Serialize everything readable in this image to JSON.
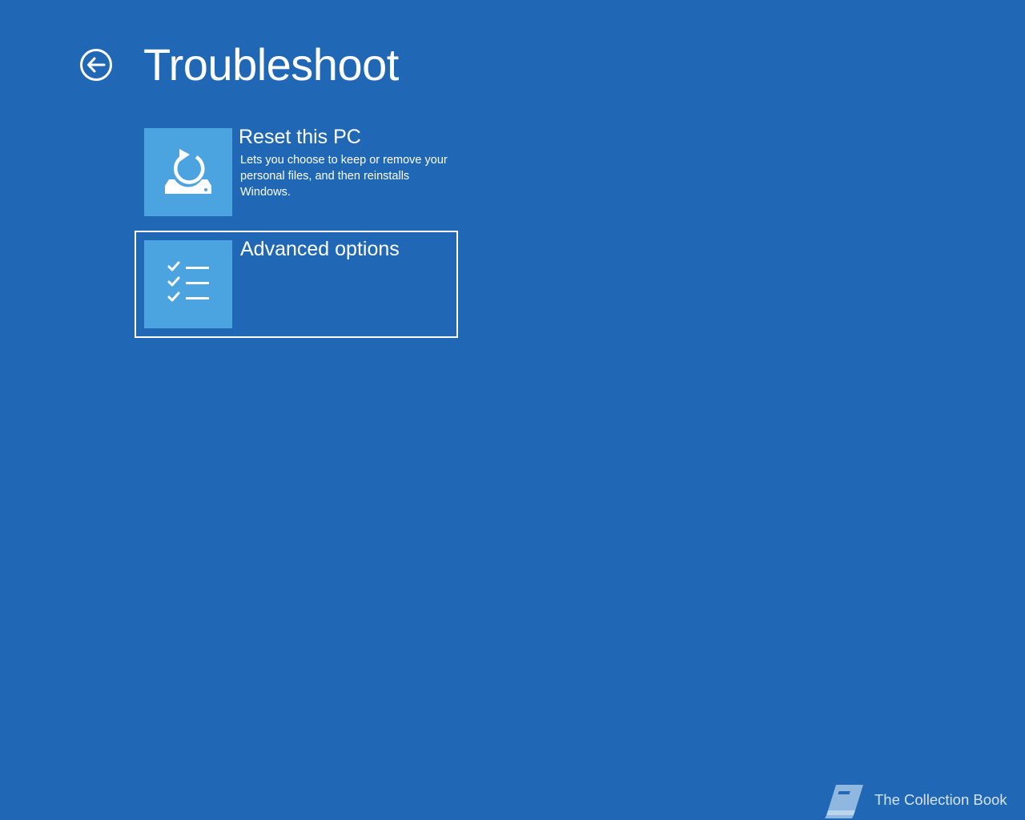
{
  "page": {
    "title": "Troubleshoot",
    "back_icon": "arrow-left-circle-icon"
  },
  "options": [
    {
      "title": "Reset this PC",
      "description": "Lets you choose to keep or remove your personal files, and then reinstalls Windows.",
      "icon": "reset-pc-icon",
      "selected": false
    },
    {
      "title": "Advanced options",
      "description": "",
      "icon": "checklist-icon",
      "selected": true
    }
  ],
  "watermark": {
    "text": "The Collection Book",
    "icon": "book-icon"
  },
  "colors": {
    "background": "#2068b5",
    "tile": "#4ba3e0",
    "text": "#ffffff"
  }
}
